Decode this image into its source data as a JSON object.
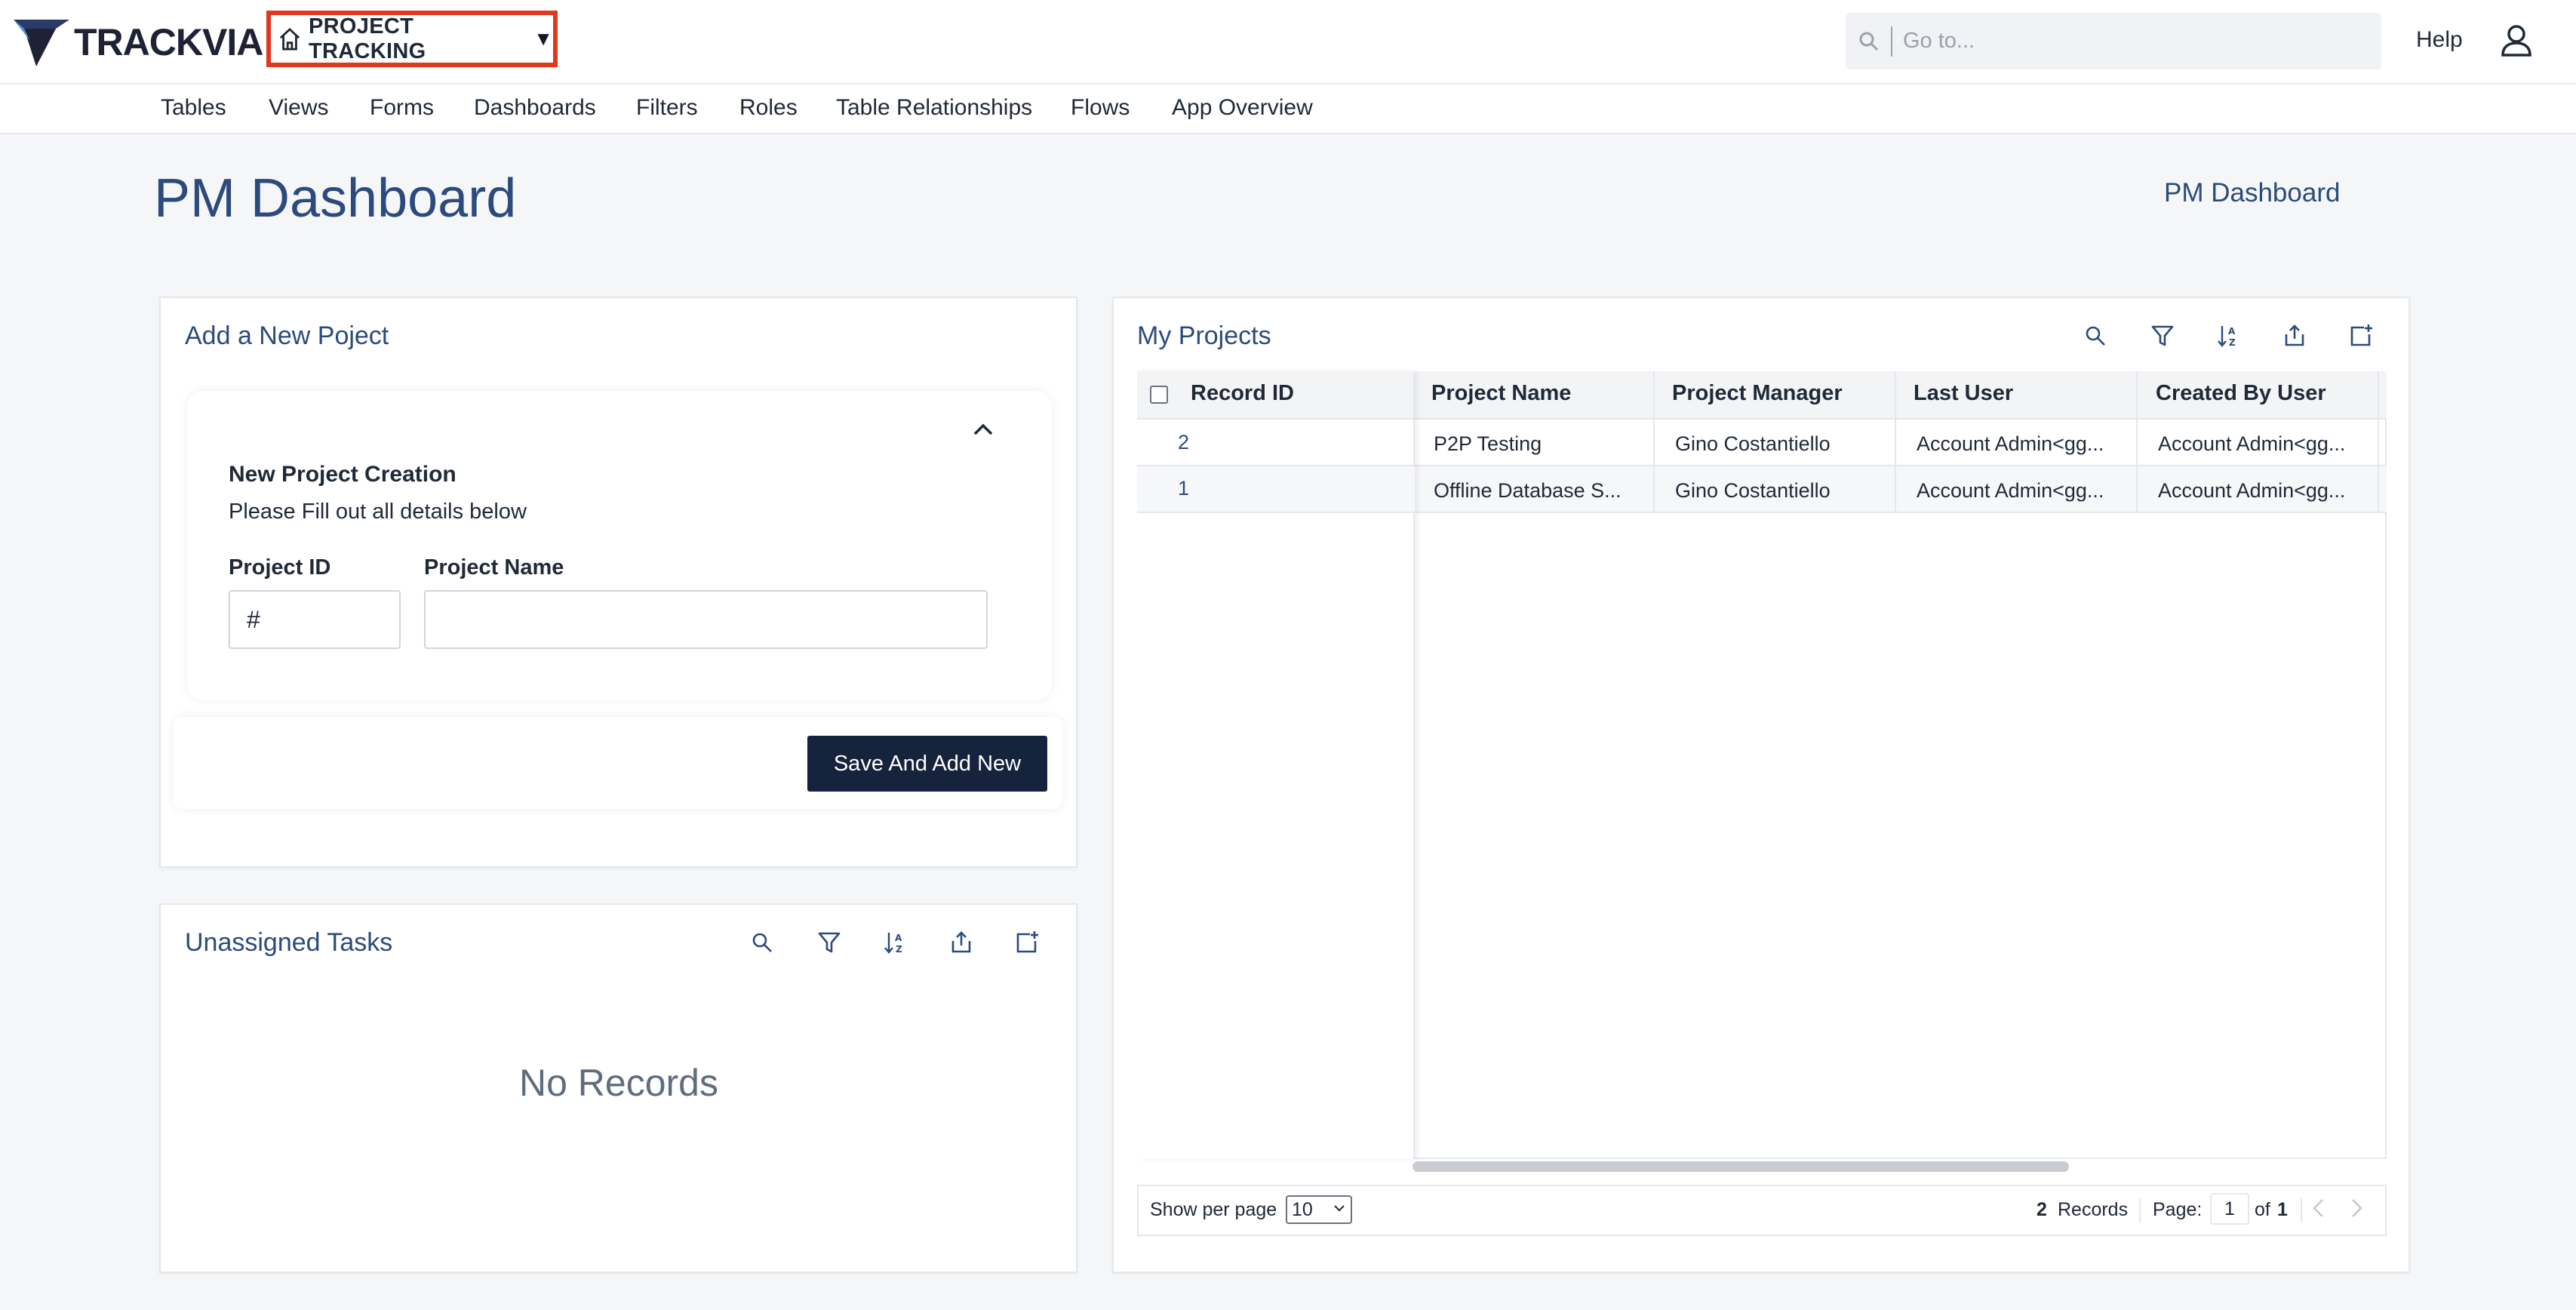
{
  "header": {
    "logo_text": "TRACKVIA",
    "app_name": "PROJECT TRACKING",
    "goto_placeholder": "Go to...",
    "help_label": "Help",
    "icons": {
      "home": "home-icon",
      "caret": "caret-down-icon",
      "search": "search-icon",
      "user": "user-icon"
    }
  },
  "nav": {
    "items": [
      "Tables",
      "Views",
      "Forms",
      "Dashboards",
      "Filters",
      "Roles",
      "Table Relationships",
      "Flows",
      "App Overview"
    ]
  },
  "page": {
    "title": "PM Dashboard",
    "breadcrumb": "PM Dashboard"
  },
  "add_project": {
    "title": "Add a New Poject",
    "heading": "New Project Creation",
    "subtext": "Please Fill out all details below",
    "fields": [
      {
        "label": "Project ID",
        "value": "#"
      },
      {
        "label": "Project Name",
        "value": ""
      }
    ],
    "save_label": "Save And Add New"
  },
  "unassigned_tasks": {
    "title": "Unassigned Tasks",
    "empty_text": "No Records"
  },
  "my_projects": {
    "title": "My Projects",
    "columns": [
      "Record ID",
      "Project Name",
      "Project Manager",
      "Last User",
      "Created By User"
    ],
    "rows": [
      {
        "record_id": "2",
        "project_name": "P2P Testing",
        "project_manager": "Gino Costantiello",
        "last_user": "Account Admin<gg...",
        "created_by": "Account Admin<gg..."
      },
      {
        "record_id": "1",
        "project_name": "Offline Database S...",
        "project_manager": "Gino Costantiello",
        "last_user": "Account Admin<gg...",
        "created_by": "Account Admin<gg..."
      }
    ],
    "pager": {
      "show_per_page_label": "Show per page",
      "per_page": "10",
      "record_count": "2",
      "records_label": "Records",
      "page_label": "Page:",
      "page": "1",
      "of_label": "of",
      "total_pages": "1"
    }
  },
  "toolbar_icons": [
    "search-icon",
    "filter-icon",
    "sort-icon",
    "export-icon",
    "add-record-icon"
  ],
  "colors": {
    "accent_blue": "#2c4a7c",
    "button_dark": "#16233d",
    "highlight_red": "#e0371f",
    "page_bg": "#f4f6f8"
  }
}
